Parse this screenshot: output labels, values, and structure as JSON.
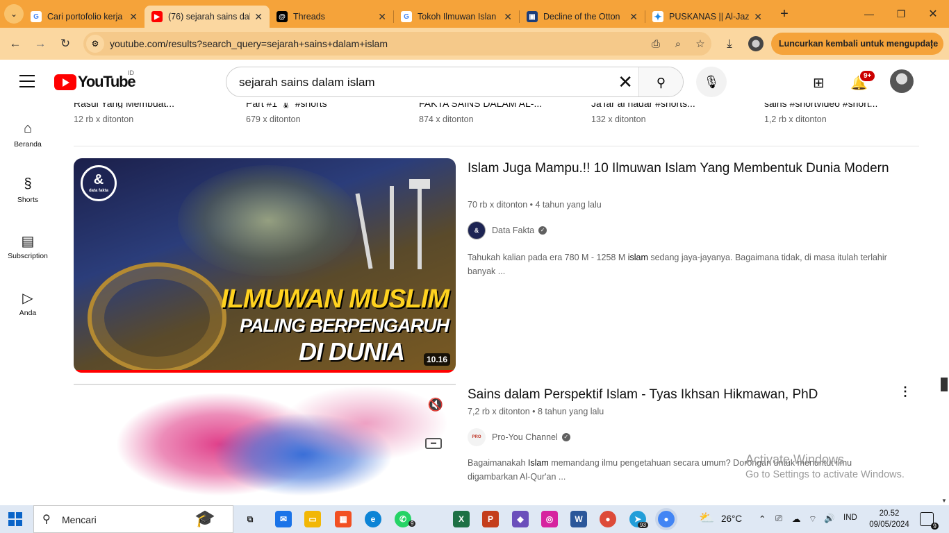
{
  "browser": {
    "tabs": [
      {
        "title": "Cari portofolio kerja",
        "favicon": "google-icon",
        "color": "#4285f4",
        "glyph": "G"
      },
      {
        "title": "(76) sejarah sains dal",
        "favicon": "youtube-icon",
        "color": "#ff0000",
        "glyph": "▶"
      },
      {
        "title": "Threads",
        "favicon": "threads-icon",
        "color": "#000000",
        "glyph": "@"
      },
      {
        "title": "Tokoh Ilmuwan Islan",
        "favicon": "google-icon",
        "color": "#4285f4",
        "glyph": "G"
      },
      {
        "title": "Decline of the Otton",
        "favicon": "library-icon",
        "color": "#1b3d7a",
        "glyph": "▣"
      },
      {
        "title": "PUSKANAS || Al-Jaza",
        "favicon": "star-icon",
        "color": "#1e88e5",
        "glyph": "✦"
      }
    ],
    "address": "youtube.com/results?search_query=sejarah+sains+dalam+islam",
    "relaunch_label": "Luncurkan kembali untuk mengupdate",
    "accent": "#f5a33a"
  },
  "youtube": {
    "logo_text": "YouTube",
    "country_code": "ID",
    "search_query": "sejarah sains dalam islam",
    "notification_count": "9+",
    "sidebar": [
      {
        "label": "Beranda",
        "icon": "home-icon",
        "glyph": "⌂"
      },
      {
        "label": "Shorts",
        "icon": "shorts-icon",
        "glyph": "§"
      },
      {
        "label": "Subscription",
        "icon": "subscriptions-icon",
        "glyph": "▤"
      },
      {
        "label": "Anda",
        "icon": "library-icon",
        "glyph": "▷"
      }
    ],
    "shorts": [
      {
        "title": "Rasul Yang Membuat...",
        "views": "12 rb x ditonton"
      },
      {
        "title": "Part #1 🌡 #shorts",
        "views": "679 x ditonton"
      },
      {
        "title": "FAKTA SAINS DALAM AL-...",
        "views": "874 x ditonton"
      },
      {
        "title": "Ja'far al hadar #shorts...",
        "views": "132 x ditonton"
      },
      {
        "title": "sains #shortvideo #short...",
        "views": "1,2 rb x ditonton"
      }
    ],
    "videos": [
      {
        "title": "Islam Juga Mampu.!! 10 Ilmuwan Islam Yang Membentuk Dunia Modern",
        "views": "70 rb x ditonton",
        "age": "4 tahun yang lalu",
        "channel": "Data Fakta",
        "desc_pre": "Tahukah kalian pada era 780 M - 1258 M ",
        "desc_bold": "islam",
        "desc_post": " sedang jaya-jayanya. Bagaimana tidak, di masa itulah terlahir banyak ...",
        "duration": "10.16",
        "thumb_text": [
          "ILMUWAN MUSLIM",
          "PALING BERPENGARUH",
          "DI DUNIA"
        ],
        "logo_text": "&",
        "logo_sub": "data fakta"
      },
      {
        "title": "Sains dalam Perspektif Islam - Tyas Ikhsan Hikmawan, PhD",
        "views": "7,2 rb x ditonton",
        "age": "8 tahun yang lalu",
        "channel": "Pro-You Channel",
        "desc_pre": "Bagaimanakah ",
        "desc_bold": "Islam",
        "desc_post": " memandang ilmu pengetahuan secara umum? Dorongan untuk menuntut ilmu digambarkan Al-Qur'an ..."
      }
    ]
  },
  "watermark": {
    "title": "Activate Windows",
    "subtitle": "Go to Settings to activate Windows."
  },
  "taskbar": {
    "search_label": "Mencari",
    "weather": "26°C",
    "language": "IND",
    "time": "20.52",
    "date": "09/05/2024",
    "notifications": "9",
    "whatsapp_badge": "9",
    "telegram_badge": "93"
  }
}
